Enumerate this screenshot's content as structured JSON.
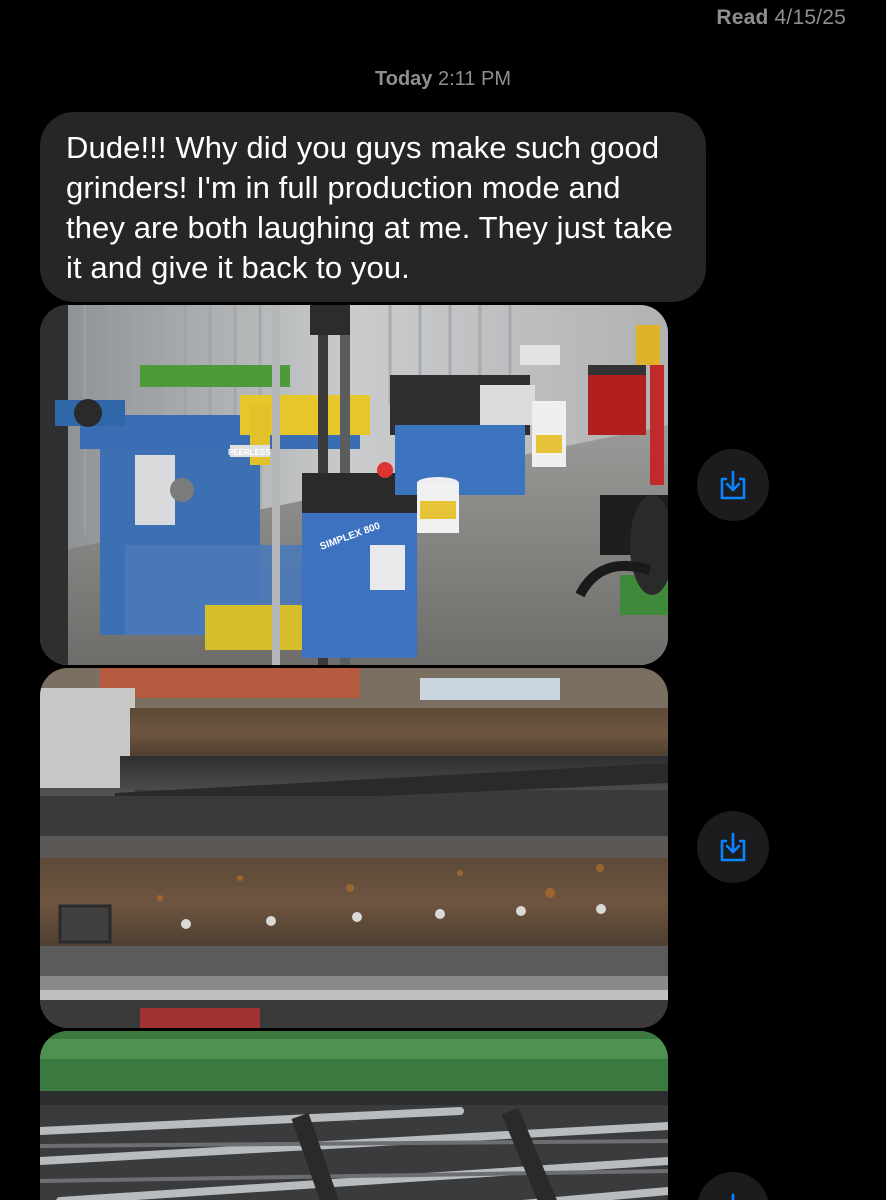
{
  "receipt": {
    "label": "Read",
    "date": "4/15/25"
  },
  "timestamp": {
    "day": "Today",
    "time": "2:11 PM"
  },
  "message": {
    "text": "Dude!!! Why did you guys make such good grinders! I'm in full production mode and they are both laughing at me. They just take it and give it back to you."
  },
  "photos": [
    {
      "save_icon": "save-to-photos-icon",
      "machine_labels": [
        "PEERLESS",
        "SIMPLEX 800"
      ]
    },
    {
      "save_icon": "save-to-photos-icon"
    },
    {
      "save_icon": "save-to-photos-icon"
    }
  ],
  "colors": {
    "background": "#000000",
    "bubble": "#262629",
    "meta_text": "#8e8e93",
    "accent": "#0a84ff"
  }
}
